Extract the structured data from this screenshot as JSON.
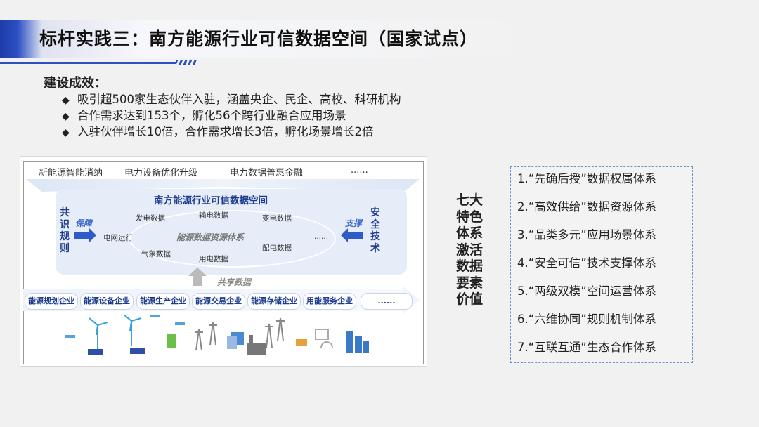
{
  "slide": {
    "title": "标杆实践三：南方能源行业可信数据空间（国家试点）"
  },
  "effects": {
    "heading": "建设成效：",
    "bullet_symbol": "◆",
    "items": [
      "吸引超500家生态伙伴入驻，涵盖央企、民企、高校、科研机构",
      "合作需求达到153个，孵化56个跨行业融合应用场景",
      "入驻伙伴增长10倍，合作需求增长3倍，孵化场景增长2倍"
    ]
  },
  "diagram": {
    "applications": [
      "新能源智能消纳",
      "电力设备优化升级",
      "电力数据普惠金融",
      "......"
    ],
    "space_title": "南方能源行业可信数据空间",
    "core": "能源数据资源体系",
    "data_nodes": {
      "generation": "发电数据",
      "transmission": "输电数据",
      "substation": "变电数据",
      "grid": "电网运行",
      "weather": "气象数据",
      "distribution": "配电数据",
      "consumption": "用电数据",
      "more": "......"
    },
    "left_vertical": "共识规则",
    "left_label": "保障",
    "right_vertical": "安全技术",
    "right_label": "支撑",
    "share_label": "共享数据",
    "enterprises": [
      "能源规划企业",
      "能源设备企业",
      "能源生产企业",
      "能源交易企业",
      "能源存储企业",
      "用能服务企业",
      "......"
    ]
  },
  "seven": {
    "label": "七大特色体系激活数据要素价值"
  },
  "systems": [
    "1.“先确后授”数据权属体系",
    "2.“高效供给”数据资源体系",
    "3.“品类多元”应用场景体系",
    "4.“安全可信”技术支撑体系",
    "5.“两级双模”空间运营体系",
    "6.“六维协同”规则机制体系",
    "7.“互联互通”生态合作体系"
  ],
  "colors": {
    "accent": "#2d4fc0",
    "diagram_text": "#1d3c8f"
  }
}
